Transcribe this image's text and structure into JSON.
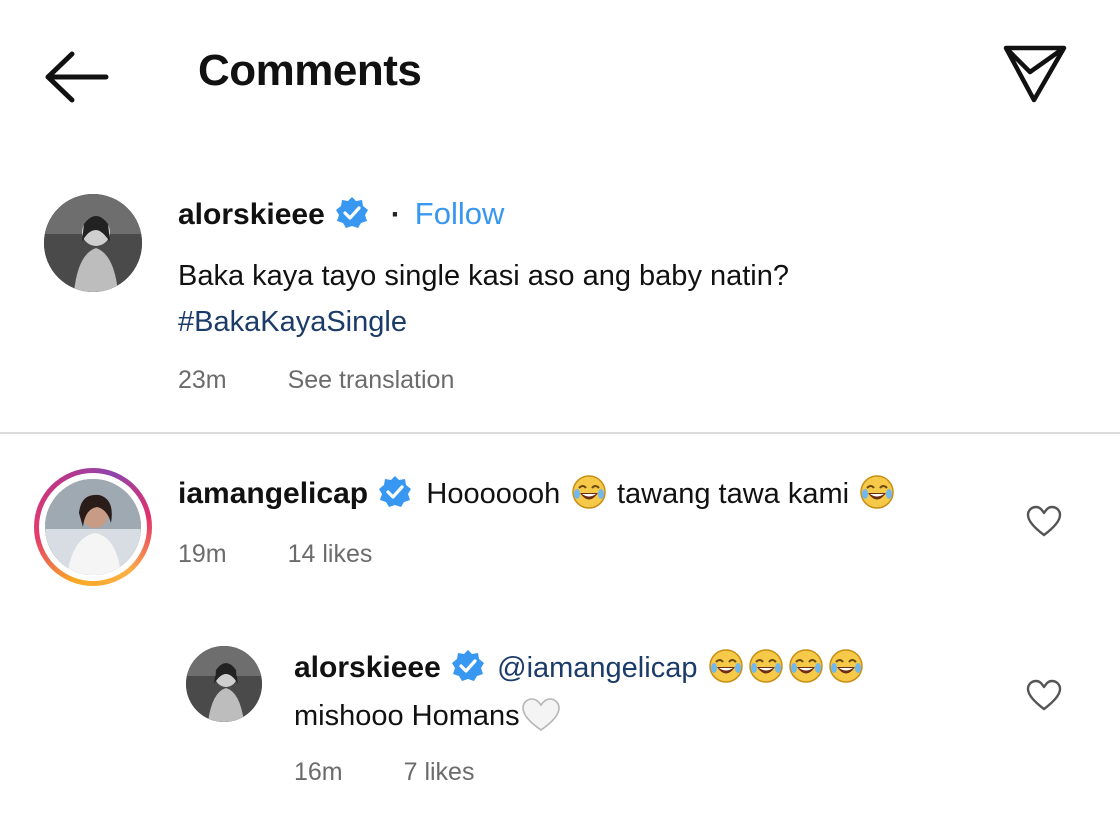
{
  "header": {
    "title": "Comments"
  },
  "post": {
    "username": "alorskieee",
    "separator": "·",
    "follow_label": "Follow",
    "caption": "Baka kaya tayo single kasi aso ang baby natin?",
    "hashtag": "#BakaKayaSingle",
    "time": "23m",
    "see_translation": "See translation"
  },
  "comments": [
    {
      "username": "iamangelicap",
      "text_part1": "Hooooooh",
      "text_part2": "tawang tawa kami",
      "time": "19m",
      "likes": "14 likes"
    }
  ],
  "reply": {
    "username": "alorskieee",
    "mention": "@iamangelicap",
    "line2": "mishooo Homans",
    "time": "16m",
    "likes": "7 likes"
  },
  "icons": {
    "back": "arrow-left-icon",
    "send": "paper-plane-icon",
    "verified": "verified-badge-icon",
    "like": "heart-outline-icon",
    "emoji": "face-with-tears-of-joy-emoji",
    "white_heart": "white-heart-emoji"
  },
  "colors": {
    "follow": "#3897f0",
    "hashtag": "#1b3b68",
    "verified": "#3897f0",
    "meta": "#6b6b6b",
    "divider": "#dbdbdb"
  }
}
